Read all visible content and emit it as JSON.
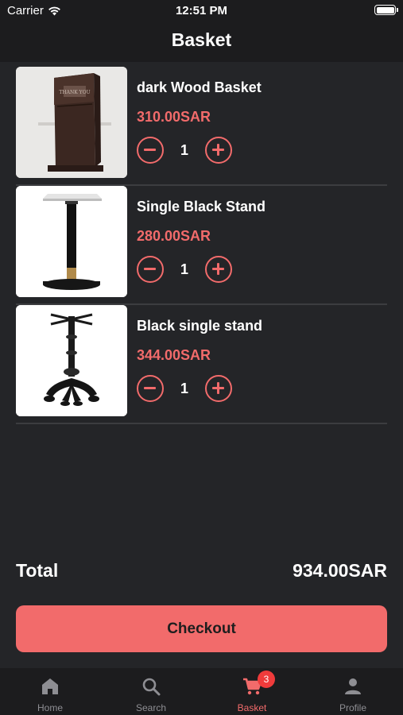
{
  "status_bar": {
    "carrier": "Carrier",
    "time": "12:51 PM"
  },
  "header": {
    "title": "Basket"
  },
  "cart": {
    "items": [
      {
        "name": "dark Wood Basket",
        "price": "310.00SAR",
        "quantity": "1",
        "image": "wood-basket-photo"
      },
      {
        "name": "Single Black Stand",
        "price": "280.00SAR",
        "quantity": "1",
        "image": "black-stand-photo"
      },
      {
        "name": "Black single stand",
        "price": "344.00SAR",
        "quantity": "1",
        "image": "ornate-stand-photo"
      }
    ],
    "total_label": "Total",
    "total_value": "934.00SAR"
  },
  "checkout": {
    "label": "Checkout"
  },
  "tab_bar": {
    "tabs": [
      {
        "label": "Home",
        "icon": "home-icon"
      },
      {
        "label": "Search",
        "icon": "search-icon"
      },
      {
        "label": "Basket",
        "icon": "cart-icon",
        "badge": "3",
        "active": true
      },
      {
        "label": "Profile",
        "icon": "person-icon"
      }
    ]
  },
  "colors": {
    "accent": "#f26b6b",
    "background": "#242528",
    "bar": "#1c1c1e",
    "badge": "#ef3b3b"
  }
}
